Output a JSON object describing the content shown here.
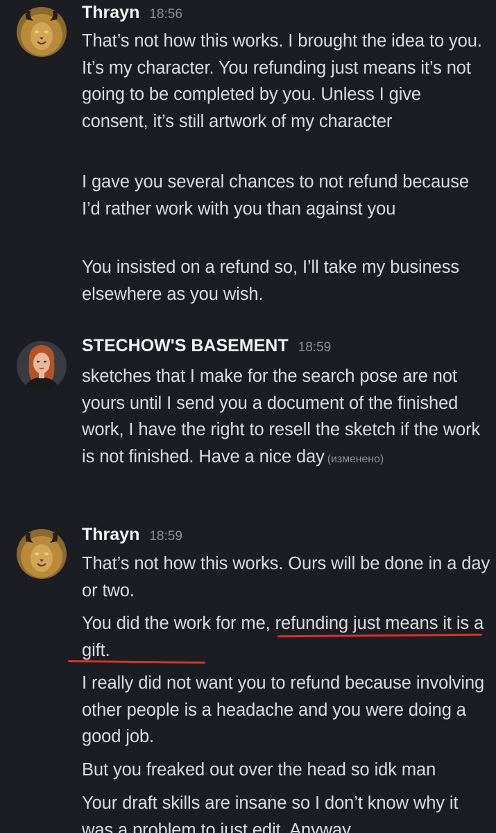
{
  "messages": [
    {
      "author": "Thrayn",
      "time": "18:56",
      "avatar": "lion-demon-avatar",
      "lines": [
        "That’s not how this works. I brought the idea to you. It’s my character. You refunding just means it’s not going to be completed by you. Unless I give consent, it’s still artwork of my character",
        "I gave you several chances to not refund because I’d rather work with you than against you",
        "You insisted on a refund so, I’ll take my business elsewhere as you wish."
      ]
    },
    {
      "author": "STECHOW'S BASEMENT",
      "time": "18:59",
      "avatar": "redhead-woman-avatar",
      "lines": [
        "sketches that I make for the search pose are not yours until I send you a document of the finished work, I have the right to resell the sketch if the work is not finished. Have a nice day"
      ],
      "edited_label": "(изменено)"
    },
    {
      "author": "Thrayn",
      "time": "18:59",
      "avatar": "lion-demon-avatar",
      "lines": [
        "That’s not how this works. Ours will be done in a day or two.",
        "You did the work for me, refunding just means it is a gift.",
        "I really did not want you to refund because involving other people is a headache and you were doing a good job.",
        "But you freaked out over the head so idk man",
        "Your draft skills are insane so I don’t know why it was a problem to just edit. Anyway"
      ]
    }
  ],
  "colors": {
    "background": "#1c1d22",
    "text": "#dbdce0",
    "author": "#f2f3f5",
    "timestamp": "#8e9096",
    "annotation_underline": "#d7322a"
  }
}
